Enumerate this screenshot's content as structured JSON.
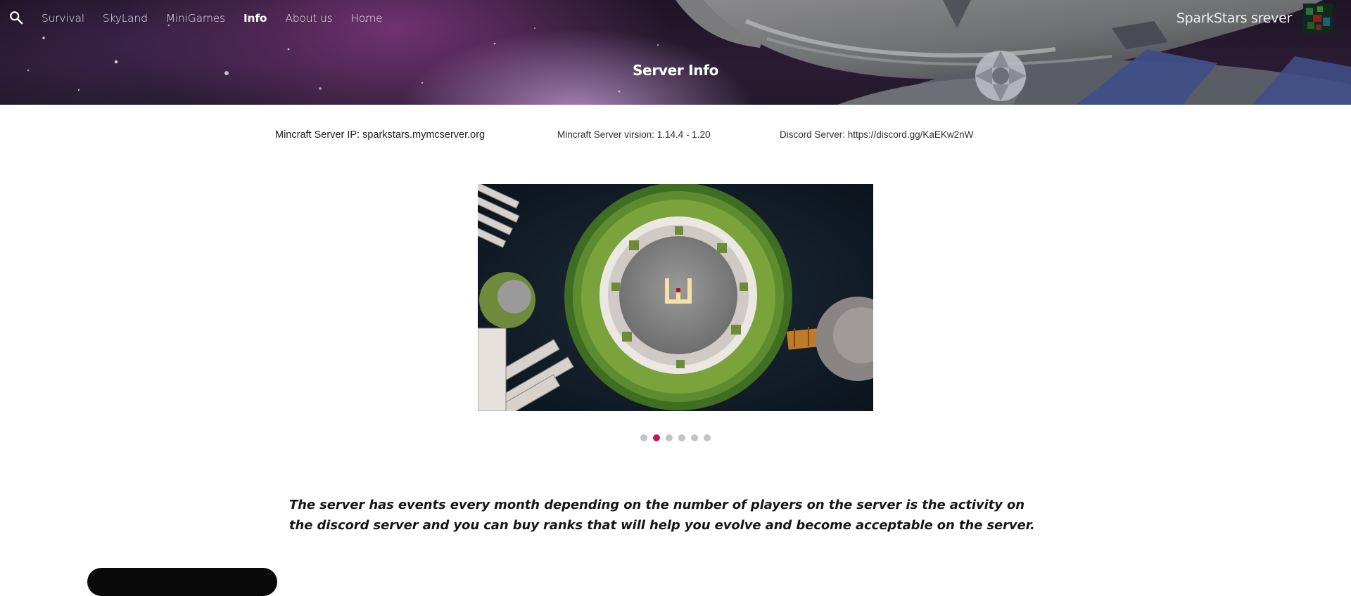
{
  "nav": {
    "menu": [
      {
        "label": "Survival",
        "active": false
      },
      {
        "label": "SkyLand",
        "active": false
      },
      {
        "label": "MiniGames",
        "active": false
      },
      {
        "label": "Info",
        "active": true
      },
      {
        "label": "About us",
        "active": false
      },
      {
        "label": "Home",
        "active": false
      }
    ],
    "site_title": "SparkStars srever"
  },
  "header": {
    "page_title": "Server Info"
  },
  "server_info": {
    "ip": "Mincraft Server IP: sparkstars.mymcserver.org",
    "version": "Mincraft Server virsion: 1.14.4 - 1.20",
    "discord": "Discord Server: https://discord.gg/KaEKw2nW"
  },
  "carousel": {
    "slide_count": 6,
    "active_index": 1
  },
  "description": "The server has events every month depending on the number of players on the server is the activity on the discord server and you can buy ranks that will help you evolve and become acceptable on the server.",
  "colors": {
    "accent": "#c2185b",
    "dot_inactive": "#c3c3c3",
    "header_bg": "#2a1b33"
  }
}
